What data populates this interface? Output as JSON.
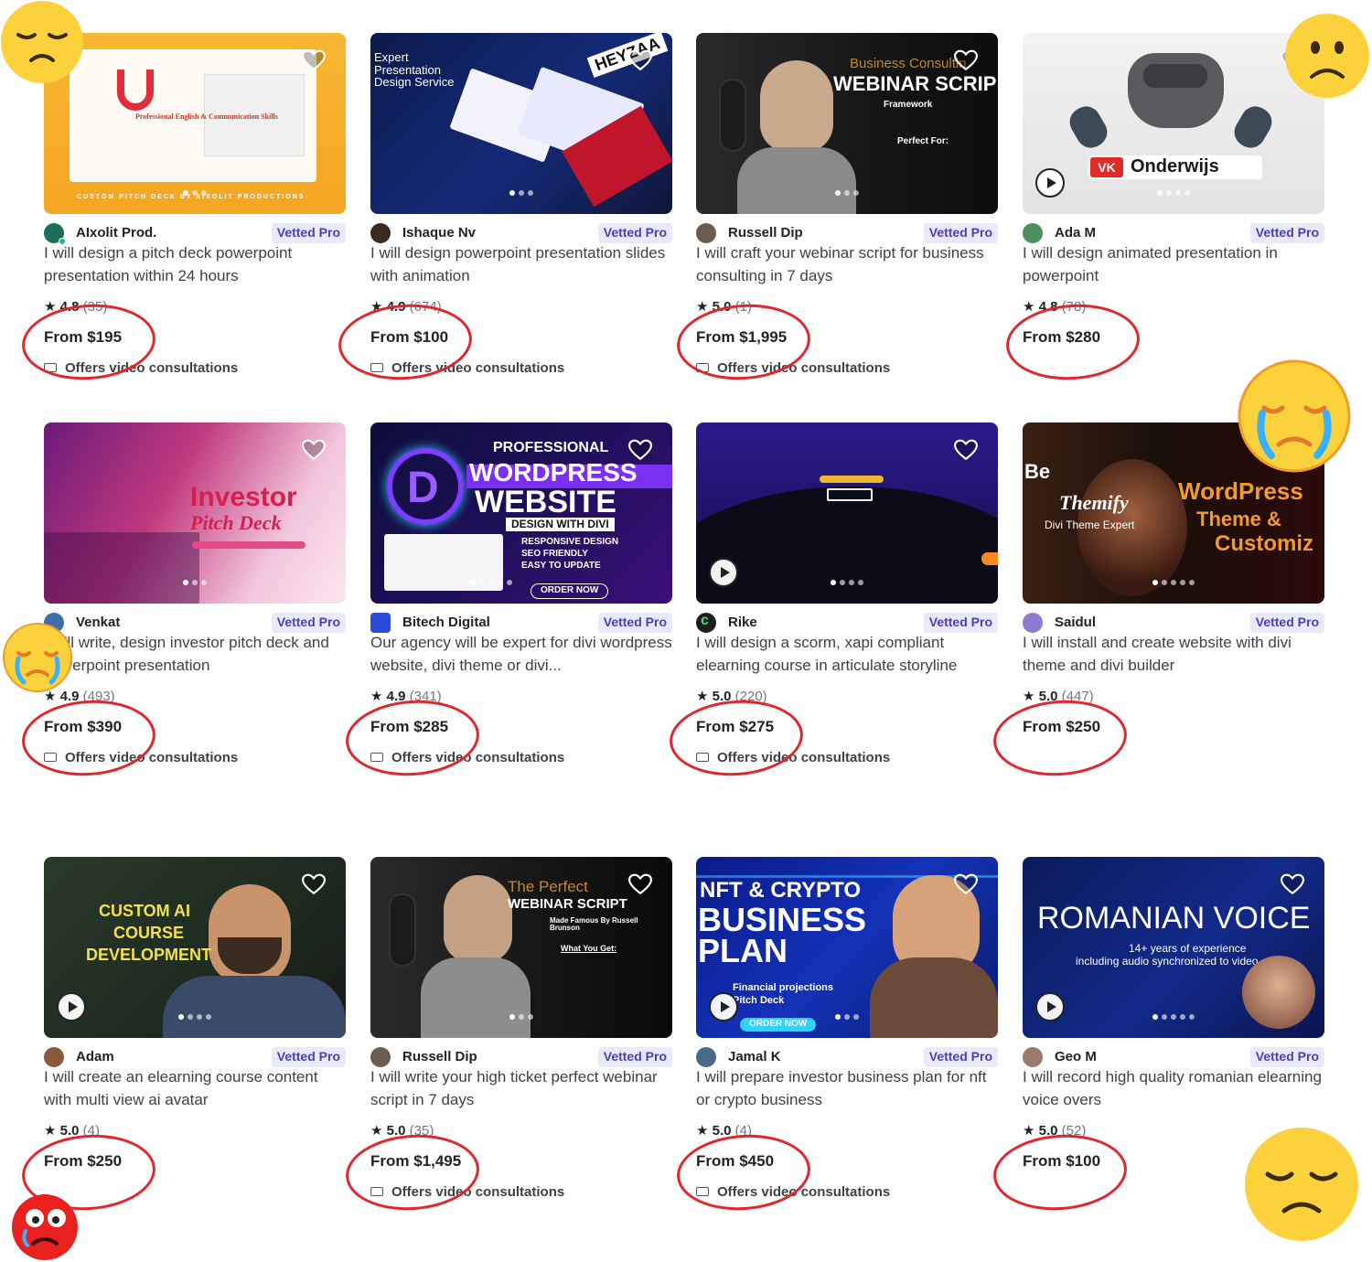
{
  "badge_label": "Vetted Pro",
  "consult_label": "Offers video consultations",
  "gigs": [
    {
      "seller": "AIxolit Prod.",
      "title": "I will design a pitch deck powerpoint presentation within 24 hours",
      "rating": "4.8",
      "count": "(35)",
      "price": "From $195",
      "consult": true,
      "thumb_lines": [
        "CUSTOM PITCH DECK BY AIXOLIT PRODUCTIONS",
        "Professional English & Communication Skills"
      ]
    },
    {
      "seller": "Ishaque Nv",
      "title": "I will design powerpoint presentation slides with animation",
      "rating": "4.9",
      "count": "(674)",
      "price": "From $100",
      "consult": true,
      "thumb_lines": [
        "Expert Presentation Design Service",
        "HEYZAA"
      ]
    },
    {
      "seller": "Russell Dip",
      "title": "I will craft your webinar script for business consulting in 7 days",
      "rating": "5.0",
      "count": "(1)",
      "price": "From $1,995",
      "consult": true,
      "thumb_lines": [
        "Business Consultin",
        "WEBINAR SCRIP",
        "Framework",
        "Perfect For:"
      ]
    },
    {
      "seller": "Ada M",
      "title": "I will design animated presentation in powerpoint",
      "rating": "4.8",
      "count": "(78)",
      "price": "From $280",
      "consult": false,
      "thumb_lines": [
        "Onderwijs"
      ]
    },
    {
      "seller": "Venkat",
      "title": "I will write, design investor pitch deck and powerpoint presentation",
      "rating": "4.9",
      "count": "(493)",
      "price": "From $390",
      "consult": true,
      "thumb_lines": [
        "Investor",
        "Pitch Deck"
      ]
    },
    {
      "seller": "Bitech Digital",
      "title": "Our agency will be expert for divi wordpress website, divi theme or divi...",
      "rating": "4.9",
      "count": "(341)",
      "price": "From $285",
      "consult": true,
      "thumb_lines": [
        "PROFESSIONAL",
        "WORDPRESS",
        "WEBSITE",
        "DESIGN WITH DIVI",
        "RESPONSIVE DESIGN",
        "SEO FRIENDLY",
        "EASY TO UPDATE",
        "ORDER NOW"
      ]
    },
    {
      "seller": "Rike",
      "title": "I will design a scorm, xapi compliant elearning course in articulate storyline",
      "rating": "5.0",
      "count": "(220)",
      "price": "From $275",
      "consult": true,
      "thumb_lines": []
    },
    {
      "seller": "Saidul",
      "title": "I will install and create website with divi theme and divi builder",
      "rating": "5.0",
      "count": "(447)",
      "price": "From $250",
      "consult": false,
      "thumb_lines": [
        "Be",
        "Themify",
        "Divi Theme Expert",
        "WordPress",
        "Theme &",
        "Customiz"
      ]
    },
    {
      "seller": "Adam",
      "title": "I will create an elearning course content with multi view ai avatar",
      "rating": "5.0",
      "count": "(4)",
      "price": "From $250",
      "consult": false,
      "thumb_lines": [
        "CUSTOM AI",
        "COURSE",
        "DEVELOPMENT"
      ]
    },
    {
      "seller": "Russell Dip",
      "title": "I will write your high ticket perfect webinar script in 7 days",
      "rating": "5.0",
      "count": "(35)",
      "price": "From $1,495",
      "consult": true,
      "thumb_lines": [
        "The Perfect",
        "WEBINAR SCRIPT",
        "Made Famous By Russell Brunson",
        "What You Get:"
      ]
    },
    {
      "seller": "Jamal K",
      "title": "I will prepare investor business plan for nft or crypto business",
      "rating": "5.0",
      "count": "(4)",
      "price": "From $450",
      "consult": true,
      "thumb_lines": [
        "NFT & CRYPTO",
        "BUSINESS",
        "PLAN",
        "Financial projections",
        "Pitch Deck",
        "ORDER NOW"
      ]
    },
    {
      "seller": "Geo M",
      "title": "I will record high quality romanian elearning voice overs",
      "rating": "5.0",
      "count": "(52)",
      "price": "From $100",
      "consult": false,
      "thumb_lines": [
        "ROMANIAN VOICE",
        "14+ years of experience",
        "including audio synchronized to video"
      ]
    }
  ],
  "colors": {
    "badge_bg": "#e9e9fb",
    "badge_text": "#4a3fb8",
    "annotation_red": "#e1262d"
  }
}
